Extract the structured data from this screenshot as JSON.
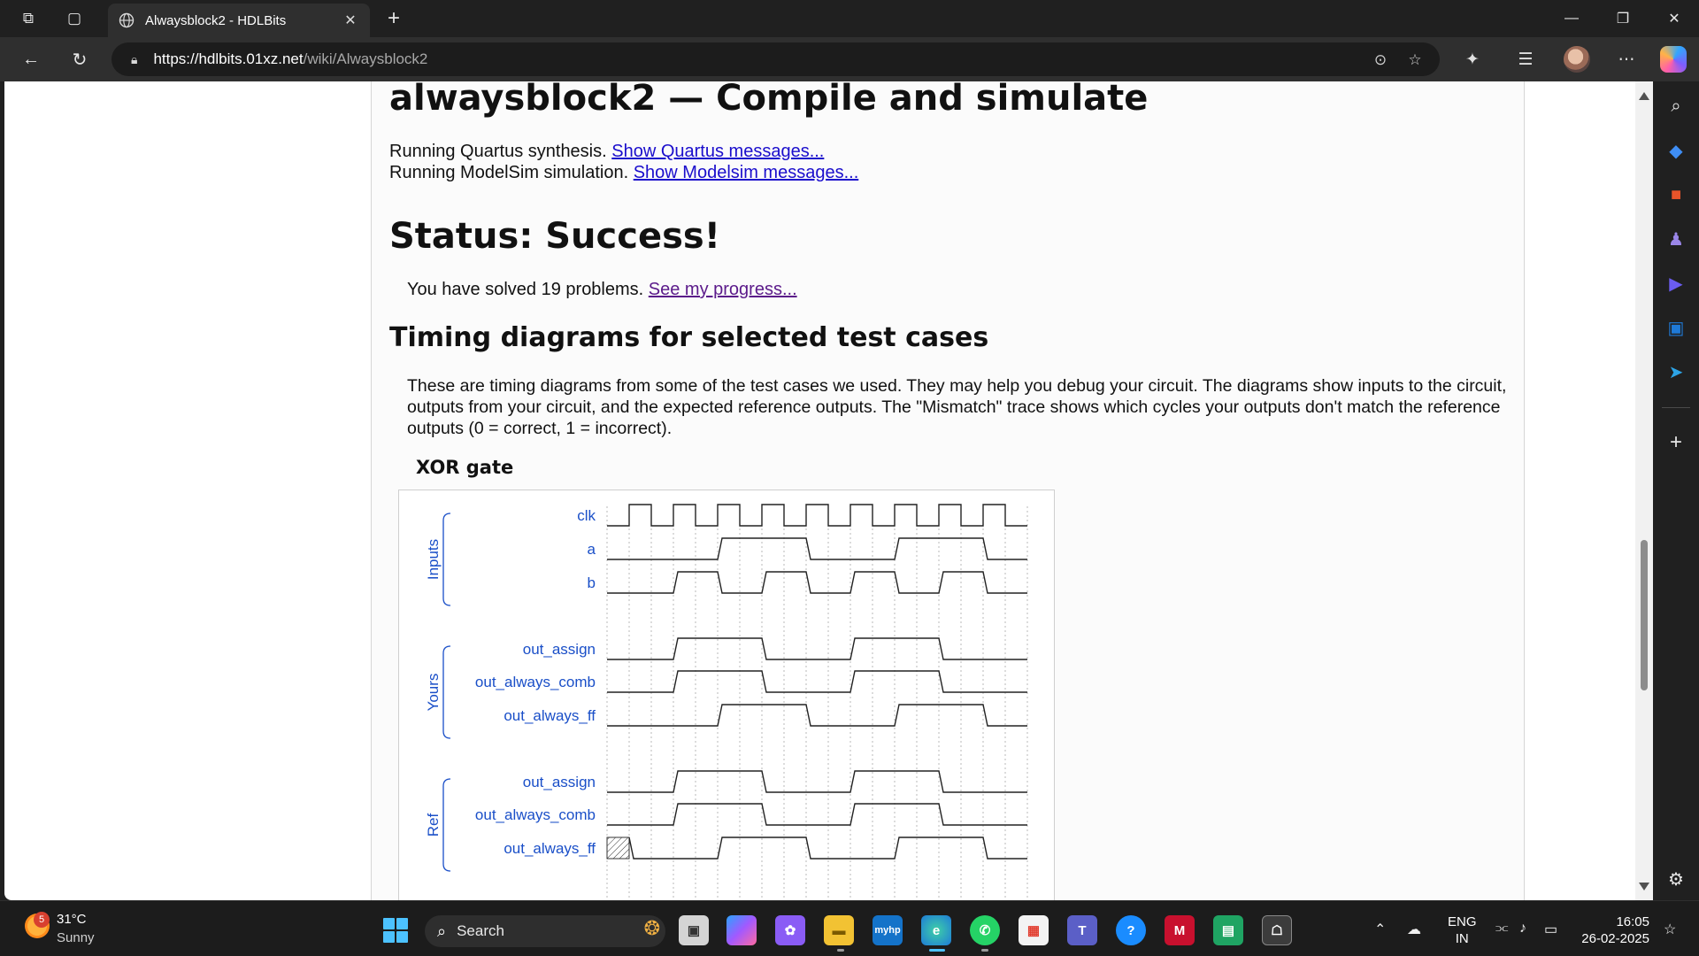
{
  "browser": {
    "tab_title": "Alwaysblock2 - HDLBits",
    "url_host": "https://hdlbits.01xz.net",
    "url_path": "/wiki/Alwaysblock2"
  },
  "page": {
    "title": "alwaysblock2 — Compile and simulate",
    "quartus_text": "Running Quartus synthesis.",
    "quartus_link": "Show Quartus messages...",
    "modelsim_text": "Running ModelSim simulation.",
    "modelsim_link": "Show Modelsim messages...",
    "status": "Status: Success!",
    "solved_text": "You have solved 19 problems.",
    "progress_link": "See my progress...",
    "timing_heading": "Timing diagrams for selected test cases",
    "timing_paragraph": "These are timing diagrams from some of the test cases we used. They may help you debug your circuit. The diagrams show inputs to the circuit, outputs from your circuit, and the expected reference outputs. The \"Mismatch\" trace shows which cycles your outputs don't match the reference outputs (0 = correct, 1 = incorrect).",
    "test_case_title": "XOR gate"
  },
  "timing_diagram": {
    "groups": [
      {
        "label": "Inputs",
        "signals": [
          {
            "name": "clk",
            "type": "clock"
          },
          {
            "name": "a",
            "levels": [
              0,
              0,
              0,
              0,
              0,
              1,
              1,
              1,
              1,
              0,
              0,
              0,
              0,
              1,
              1,
              1,
              1,
              0,
              0
            ]
          },
          {
            "name": "b",
            "levels": [
              0,
              0,
              0,
              1,
              1,
              0,
              0,
              1,
              1,
              0,
              0,
              1,
              1,
              0,
              0,
              1,
              1,
              0,
              0
            ]
          }
        ]
      },
      {
        "label": "Yours",
        "signals": [
          {
            "name": "out_assign",
            "levels": [
              0,
              0,
              0,
              1,
              1,
              1,
              1,
              0,
              0,
              0,
              0,
              1,
              1,
              1,
              1,
              0,
              0,
              0,
              0
            ]
          },
          {
            "name": "out_always_comb",
            "levels": [
              0,
              0,
              0,
              1,
              1,
              1,
              1,
              0,
              0,
              0,
              0,
              1,
              1,
              1,
              1,
              0,
              0,
              0,
              0
            ]
          },
          {
            "name": "out_always_ff",
            "levels": [
              0,
              0,
              0,
              0,
              0,
              1,
              1,
              1,
              1,
              0,
              0,
              0,
              0,
              1,
              1,
              1,
              1,
              0,
              0
            ]
          }
        ]
      },
      {
        "label": "Ref",
        "signals": [
          {
            "name": "out_assign",
            "levels": [
              0,
              0,
              0,
              1,
              1,
              1,
              1,
              0,
              0,
              0,
              0,
              1,
              1,
              1,
              1,
              0,
              0,
              0,
              0
            ]
          },
          {
            "name": "out_always_comb",
            "levels": [
              0,
              0,
              0,
              1,
              1,
              1,
              1,
              0,
              0,
              0,
              0,
              1,
              1,
              1,
              1,
              0,
              0,
              0,
              0
            ]
          },
          {
            "name": "out_always_ff",
            "levels": [
              "x",
              0,
              0,
              0,
              0,
              1,
              1,
              1,
              1,
              0,
              0,
              0,
              0,
              1,
              1,
              1,
              1,
              0,
              0
            ]
          }
        ]
      }
    ],
    "trace_color": "#222222",
    "label_color": "#1a4fc8"
  },
  "taskbar": {
    "weather_temp": "31°C",
    "weather_desc": "Sunny",
    "weather_badge": "5",
    "search_label": "Search",
    "lang_line1": "ENG",
    "lang_line2": "IN",
    "time": "16:05",
    "date": "26-02-2025"
  }
}
